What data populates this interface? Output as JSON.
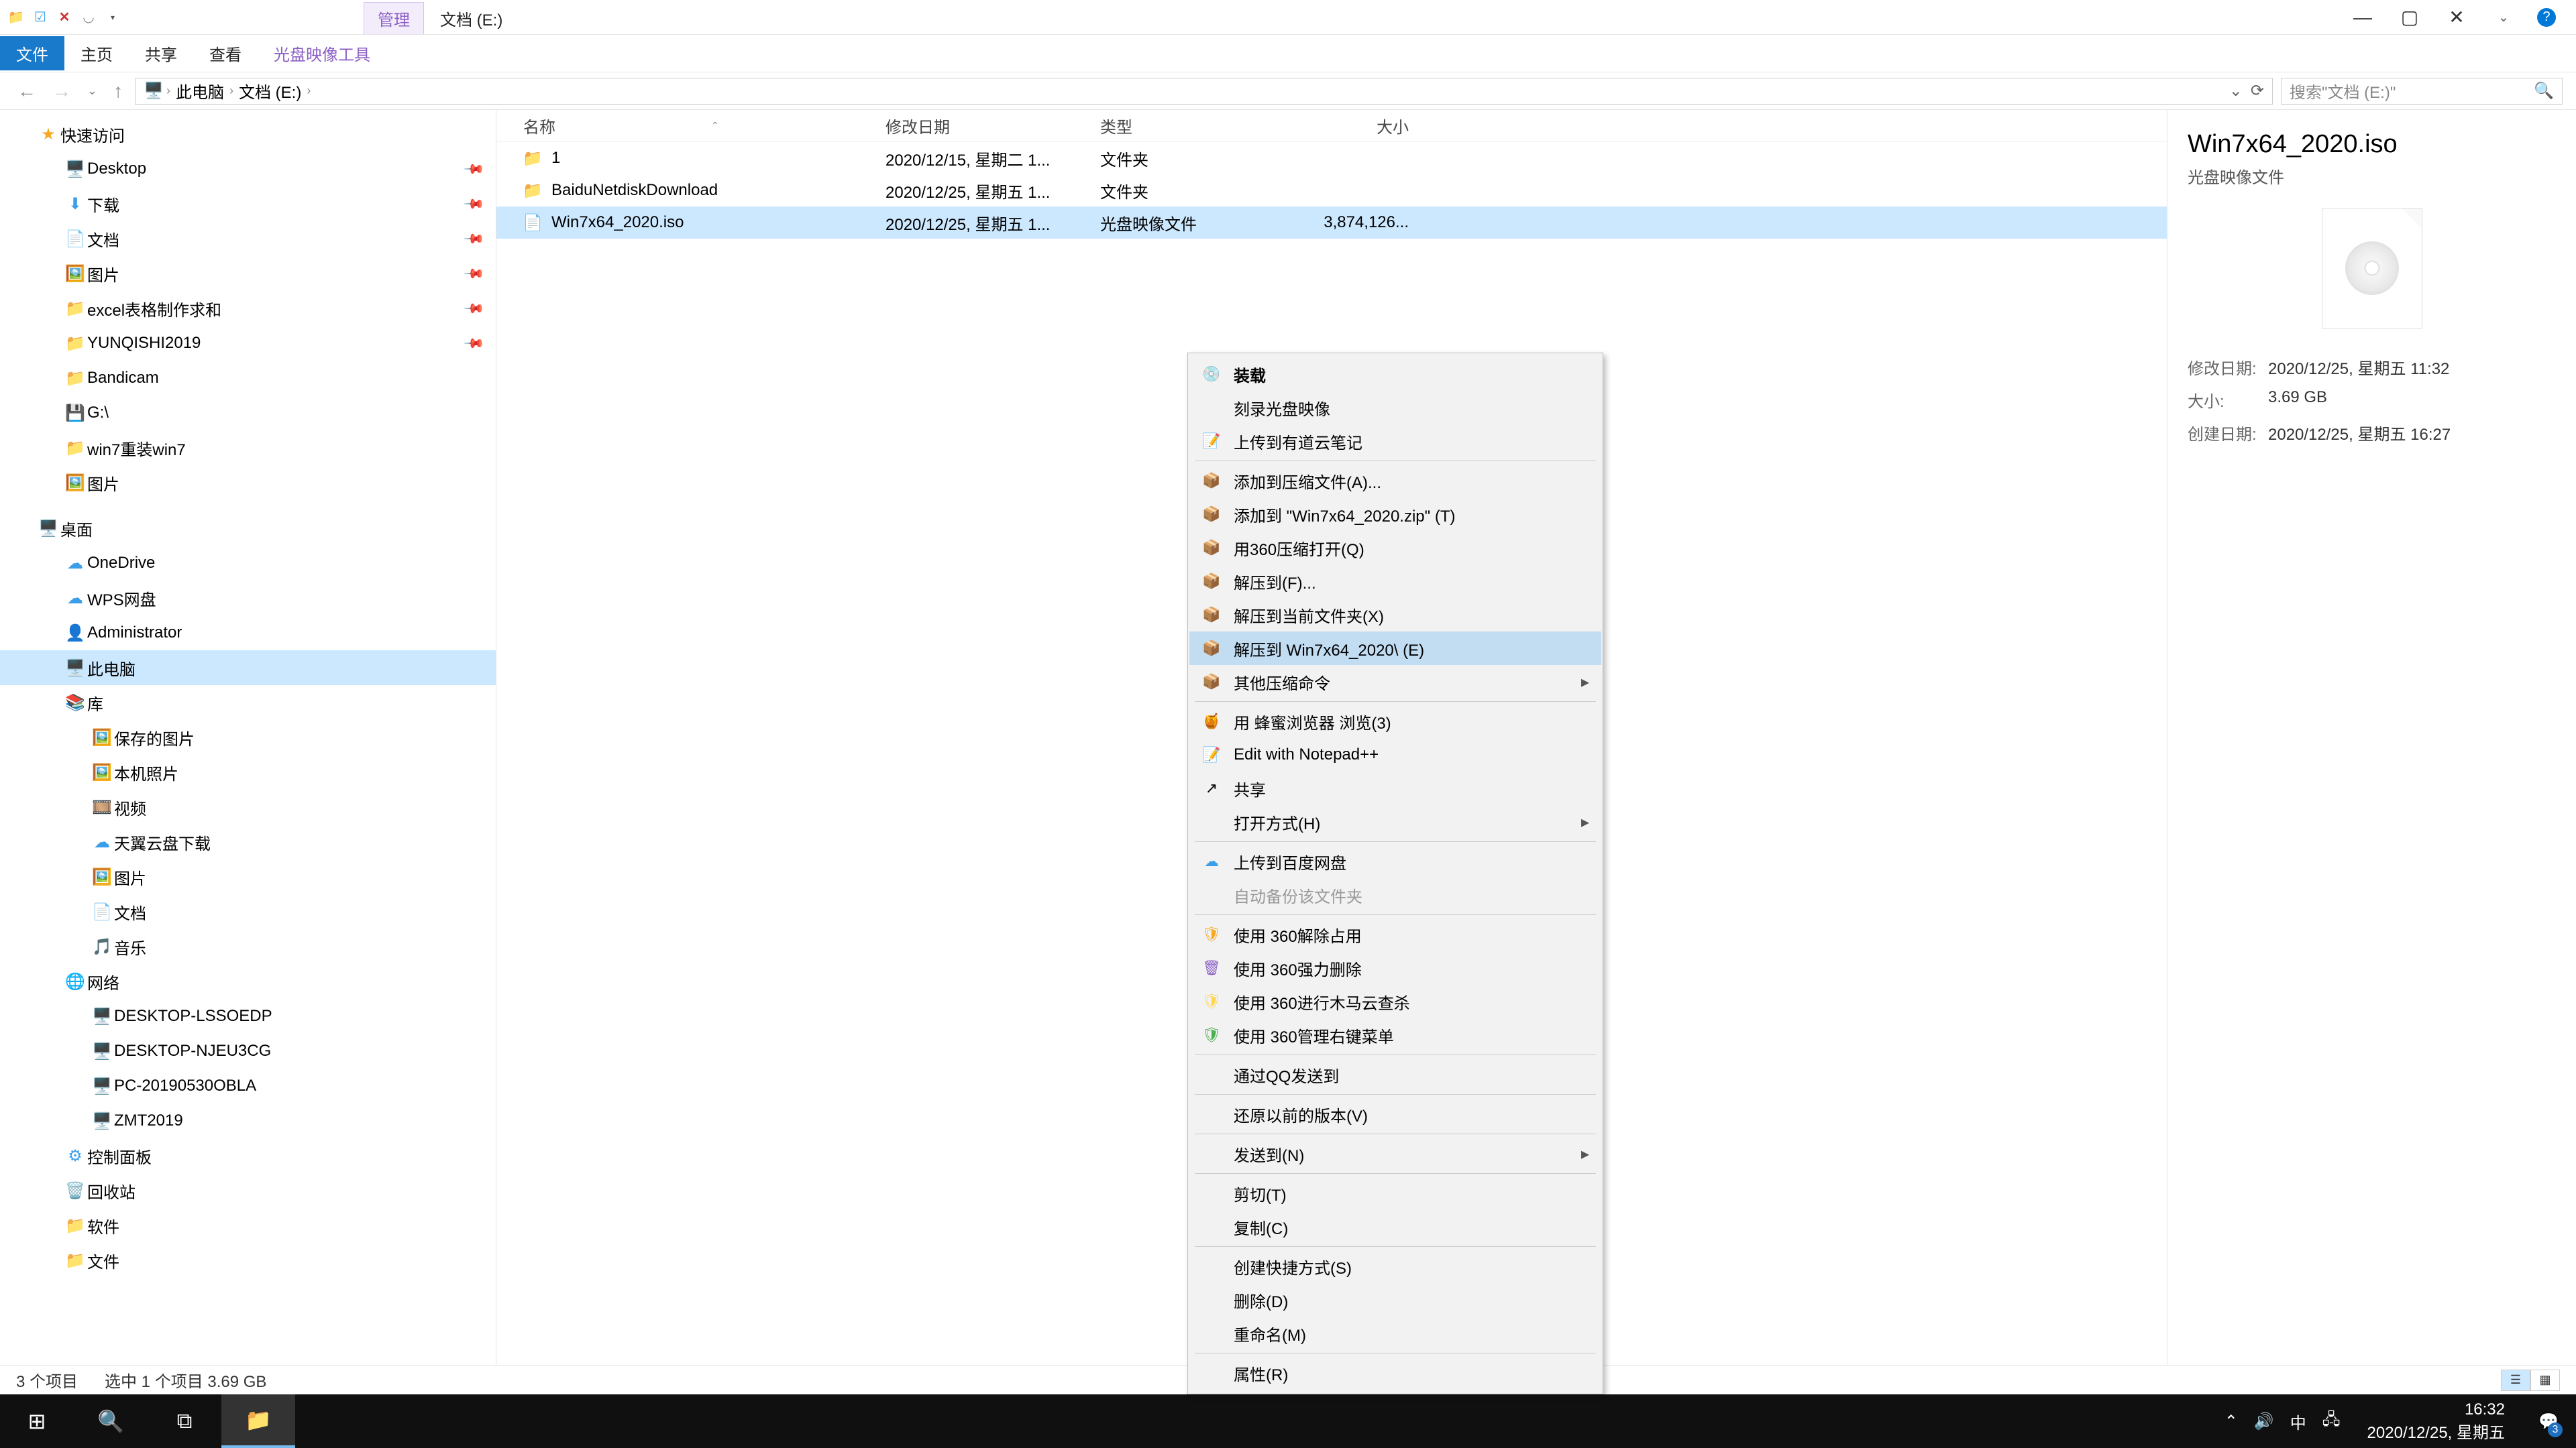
{
  "titlebar": {
    "manage_tab": "管理",
    "location_tab": "文档 (E:)"
  },
  "ribbon": {
    "file": "文件",
    "home": "主页",
    "share": "共享",
    "view": "查看",
    "tool": "光盘映像工具"
  },
  "address": {
    "root": "此电脑",
    "drive": "文档 (E:)",
    "search_placeholder": "搜索\"文档 (E:)\""
  },
  "columns": {
    "name": "名称",
    "date": "修改日期",
    "type": "类型",
    "size": "大小"
  },
  "rows": [
    {
      "icon": "📁",
      "name": "1",
      "date": "2020/12/15, 星期二 1...",
      "type": "文件夹",
      "size": ""
    },
    {
      "icon": "📁",
      "name": "BaiduNetdiskDownload",
      "date": "2020/12/25, 星期五 1...",
      "type": "文件夹",
      "size": ""
    },
    {
      "icon": "📄",
      "name": "Win7x64_2020.iso",
      "date": "2020/12/25, 星期五 1...",
      "type": "光盘映像文件",
      "size": "3,874,126...",
      "selected": true
    }
  ],
  "tree": {
    "quick": "快速访问",
    "items_quick": [
      {
        "ic": "🖥️",
        "label": "Desktop",
        "pin": true,
        "cls": "ic-blue"
      },
      {
        "ic": "⬇",
        "label": "下载",
        "pin": true,
        "cls": "ic-blue"
      },
      {
        "ic": "📄",
        "label": "文档",
        "pin": true,
        "cls": "ic-blue"
      },
      {
        "ic": "🖼️",
        "label": "图片",
        "pin": true,
        "cls": "ic-blue"
      },
      {
        "ic": "📁",
        "label": "excel表格制作求和",
        "pin": true,
        "cls": "ic-folder"
      },
      {
        "ic": "📁",
        "label": "YUNQISHI2019",
        "pin": true,
        "cls": "ic-folder"
      },
      {
        "ic": "📁",
        "label": "Bandicam",
        "pin": false,
        "cls": "ic-folder"
      },
      {
        "ic": "💾",
        "label": "G:\\",
        "pin": false,
        "cls": "ic-disk"
      },
      {
        "ic": "📁",
        "label": "win7重装win7",
        "pin": false,
        "cls": "ic-folder"
      },
      {
        "ic": "🖼️",
        "label": "图片",
        "pin": false,
        "cls": "ic-blue"
      }
    ],
    "desktop": "桌面",
    "items_desktop": [
      {
        "ic": "☁",
        "label": "OneDrive",
        "cls": "ic-blue"
      },
      {
        "ic": "☁",
        "label": "WPS网盘",
        "cls": "ic-blue"
      },
      {
        "ic": "👤",
        "label": "Administrator",
        "cls": "ic-gray"
      },
      {
        "ic": "🖥️",
        "label": "此电脑",
        "cls": "ic-blue",
        "selected": true
      },
      {
        "ic": "📚",
        "label": "库",
        "cls": "ic-blue"
      }
    ],
    "items_lib": [
      {
        "ic": "🖼️",
        "label": "保存的图片",
        "cls": "ic-blue"
      },
      {
        "ic": "🖼️",
        "label": "本机照片",
        "cls": "ic-blue"
      },
      {
        "ic": "🎞️",
        "label": "视频",
        "cls": "ic-blue"
      },
      {
        "ic": "☁",
        "label": "天翼云盘下载",
        "cls": "ic-blue"
      },
      {
        "ic": "🖼️",
        "label": "图片",
        "cls": "ic-blue"
      },
      {
        "ic": "📄",
        "label": "文档",
        "cls": "ic-blue"
      },
      {
        "ic": "🎵",
        "label": "音乐",
        "cls": "ic-blue"
      }
    ],
    "network": "网络",
    "items_net": [
      {
        "ic": "🖥️",
        "label": "DESKTOP-LSSOEDP",
        "cls": "ic-gray"
      },
      {
        "ic": "🖥️",
        "label": "DESKTOP-NJEU3CG",
        "cls": "ic-gray"
      },
      {
        "ic": "🖥️",
        "label": "PC-20190530OBLA",
        "cls": "ic-gray"
      },
      {
        "ic": "🖥️",
        "label": "ZMT2019",
        "cls": "ic-gray"
      }
    ],
    "items_tail": [
      {
        "ic": "⚙",
        "label": "控制面板",
        "cls": "ic-blue"
      },
      {
        "ic": "🗑️",
        "label": "回收站",
        "cls": "ic-gray"
      },
      {
        "ic": "📁",
        "label": "软件",
        "cls": "ic-folder"
      },
      {
        "ic": "📁",
        "label": "文件",
        "cls": "ic-folder"
      }
    ]
  },
  "context": [
    {
      "ic": "💿",
      "label": "装载",
      "bold": true
    },
    {
      "ic": "",
      "label": "刻录光盘映像"
    },
    {
      "ic": "📝",
      "label": "上传到有道云笔记",
      "cls": "ic-blue"
    },
    {
      "sep": true
    },
    {
      "ic": "📦",
      "label": "添加到压缩文件(A)...",
      "cls": "ic-orange"
    },
    {
      "ic": "📦",
      "label": "添加到 \"Win7x64_2020.zip\" (T)",
      "cls": "ic-orange"
    },
    {
      "ic": "📦",
      "label": "用360压缩打开(Q)",
      "cls": "ic-orange"
    },
    {
      "ic": "📦",
      "label": "解压到(F)...",
      "cls": "ic-orange"
    },
    {
      "ic": "📦",
      "label": "解压到当前文件夹(X)",
      "cls": "ic-orange"
    },
    {
      "ic": "📦",
      "label": "解压到 Win7x64_2020\\ (E)",
      "cls": "ic-orange",
      "hl": true
    },
    {
      "ic": "📦",
      "label": "其他压缩命令",
      "cls": "ic-orange",
      "sub": true
    },
    {
      "sep": true
    },
    {
      "ic": "🍯",
      "label": "用 蜂蜜浏览器 浏览(3)",
      "cls": "ic-green"
    },
    {
      "ic": "📝",
      "label": "Edit with Notepad++",
      "cls": "ic-green"
    },
    {
      "ic": "↗",
      "label": "共享"
    },
    {
      "ic": "",
      "label": "打开方式(H)",
      "sub": true
    },
    {
      "sep": true
    },
    {
      "ic": "☁",
      "label": "上传到百度网盘",
      "cls": "ic-blue"
    },
    {
      "ic": "",
      "label": "自动备份该文件夹",
      "disabled": true
    },
    {
      "sep": true
    },
    {
      "ic": "🛡",
      "label": "使用 360解除占用",
      "cls": "ic-orange"
    },
    {
      "ic": "🗑",
      "label": "使用 360强力删除",
      "cls": "ic-purple"
    },
    {
      "ic": "🛡",
      "label": "使用 360进行木马云查杀",
      "cls": "ic-yellow"
    },
    {
      "ic": "🛡",
      "label": "使用 360管理右键菜单",
      "cls": "ic-green"
    },
    {
      "sep": true
    },
    {
      "ic": "",
      "label": "通过QQ发送到"
    },
    {
      "sep": true
    },
    {
      "ic": "",
      "label": "还原以前的版本(V)"
    },
    {
      "sep": true
    },
    {
      "ic": "",
      "label": "发送到(N)",
      "sub": true
    },
    {
      "sep": true
    },
    {
      "ic": "",
      "label": "剪切(T)"
    },
    {
      "ic": "",
      "label": "复制(C)"
    },
    {
      "sep": true
    },
    {
      "ic": "",
      "label": "创建快捷方式(S)"
    },
    {
      "ic": "",
      "label": "删除(D)"
    },
    {
      "ic": "",
      "label": "重命名(M)"
    },
    {
      "sep": true
    },
    {
      "ic": "",
      "label": "属性(R)"
    }
  ],
  "preview": {
    "title": "Win7x64_2020.iso",
    "type": "光盘映像文件",
    "mod_k": "修改日期:",
    "mod_v": "2020/12/25, 星期五 11:32",
    "size_k": "大小:",
    "size_v": "3.69 GB",
    "created_k": "创建日期:",
    "created_v": "2020/12/25, 星期五 16:27"
  },
  "status": {
    "count": "3 个项目",
    "selection": "选中 1 个项目  3.69 GB"
  },
  "taskbar": {
    "time": "16:32",
    "date": "2020/12/25, 星期五",
    "ime": "中",
    "badge": "3"
  }
}
